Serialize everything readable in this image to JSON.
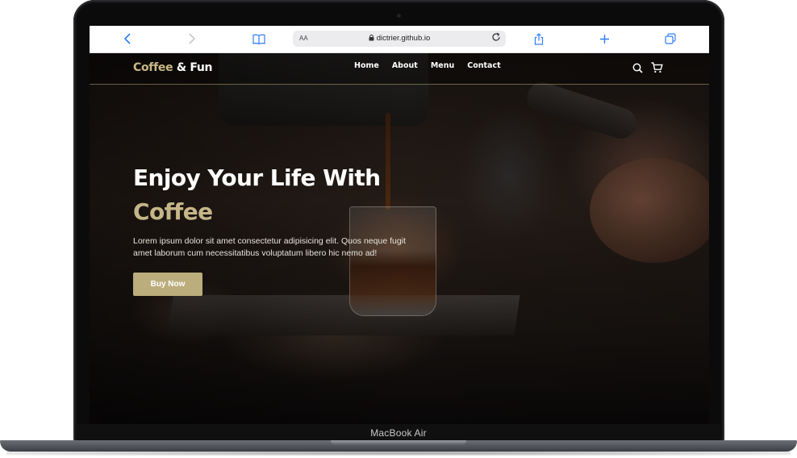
{
  "device": {
    "label": "MacBook Air"
  },
  "browser": {
    "address_small_text": "AA",
    "url": "dictrier.github.io",
    "icons": {
      "back": "chevron-left-icon",
      "forward": "chevron-right-icon",
      "bookmarks": "book-icon",
      "lock": "lock-icon",
      "reload": "reload-icon",
      "share": "share-icon",
      "new_tab": "plus-icon",
      "tabs": "tabs-icon"
    },
    "accent_color": "#2f7df6"
  },
  "site": {
    "logo": {
      "part1": "Coffee",
      "part2": "& Fun"
    },
    "nav": [
      {
        "label": "Home"
      },
      {
        "label": "About"
      },
      {
        "label": "Menu"
      },
      {
        "label": "Contact"
      }
    ],
    "nav_icons": {
      "search": "search-icon",
      "cart": "cart-icon"
    },
    "hero": {
      "title_line1": "Enjoy Your Life With",
      "title_line2": "Coffee",
      "description": "Lorem ipsum dolor sit amet consectetur adipisicing elit. Quos neque fugit amet laborum cum necessitatibus voluptatum libero hic nemo ad!",
      "button": "Buy Now"
    },
    "colors": {
      "accent": "#bbad7c",
      "text": "#ffffff"
    }
  }
}
